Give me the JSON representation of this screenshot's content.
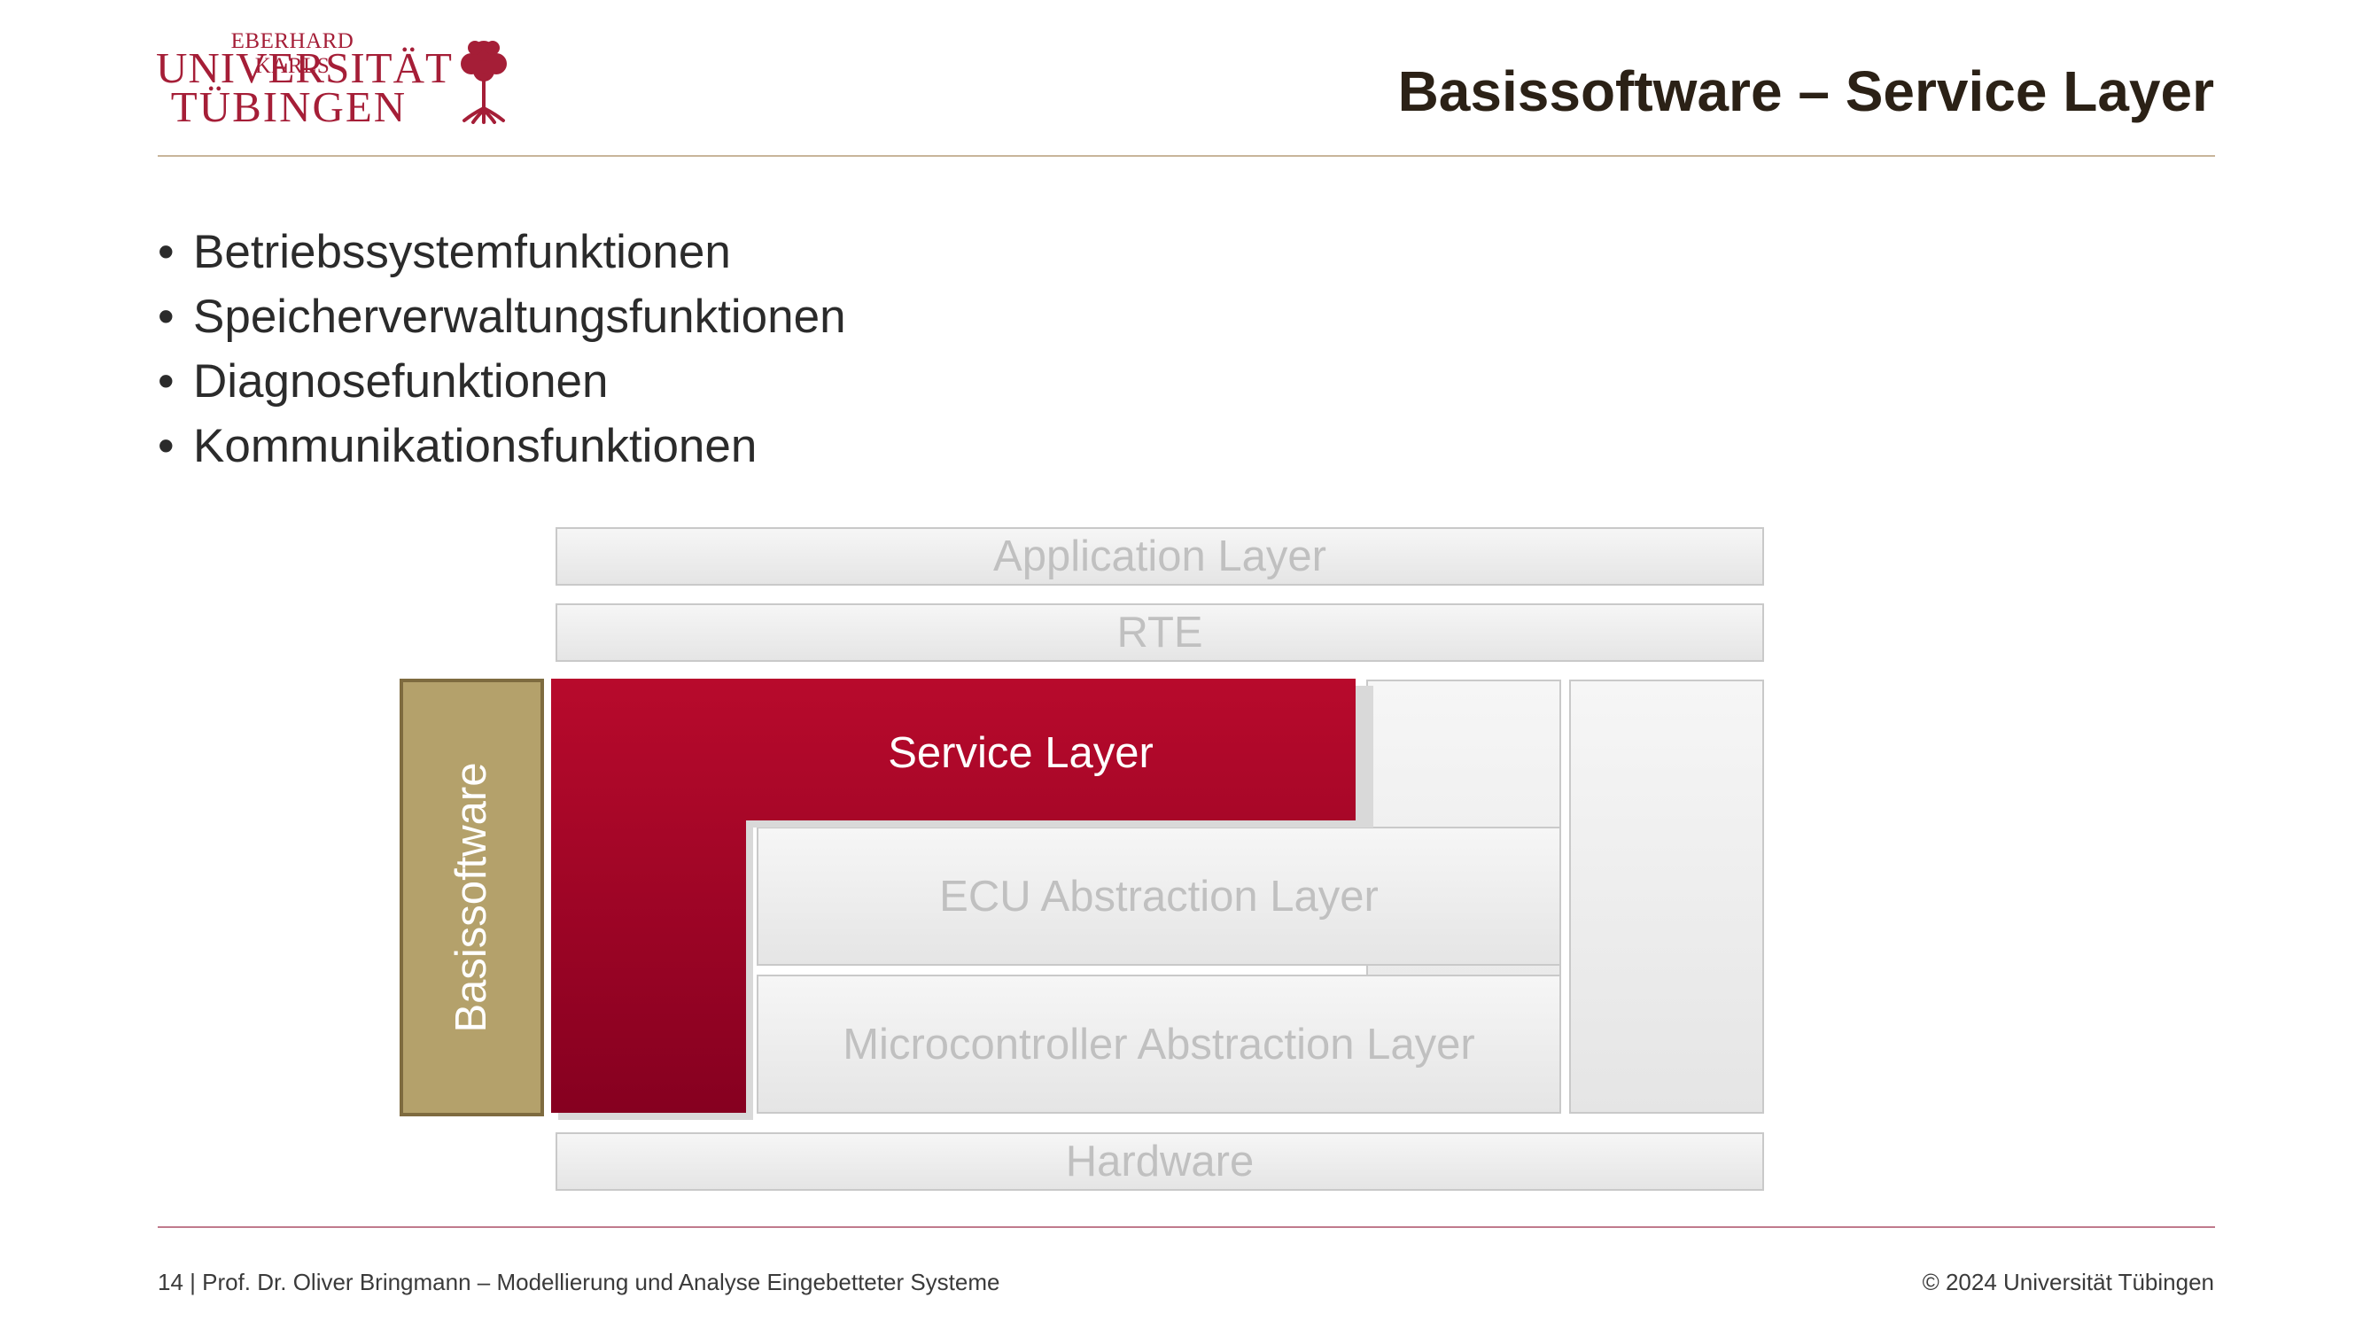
{
  "logo": {
    "line1": "EBERHARD KARLS",
    "line2": "UNIVERSITÄT",
    "line3": "TÜBINGEN",
    "icon": "tree-icon",
    "color": "#a51e37"
  },
  "slide": {
    "title": "Basissoftware – Service Layer",
    "bullets": [
      "Betriebssystemfunktionen",
      "Speicherverwaltungsfunktionen",
      "Diagnosefunktionen",
      "Kommunikationsfunktionen"
    ]
  },
  "diagram": {
    "application_layer": "Application Layer",
    "rte": "RTE",
    "service_layer": "Service Layer",
    "ecu_abstraction_layer": "ECU Abstraction Layer",
    "microcontroller_abstraction_layer": "Microcontroller Abstraction Layer",
    "hardware": "Hardware",
    "basissoftware": "Basissoftware",
    "colors": {
      "service_layer": "#b0082a",
      "basissoftware": "#b4a16b",
      "inactive_layer_text": "#c0c0c0"
    }
  },
  "footer": {
    "left": "14 | Prof. Dr. Oliver Bringmann – Modellierung und Analyse Eingebetteter Systeme",
    "right": "© 2024 Universität Tübingen"
  }
}
